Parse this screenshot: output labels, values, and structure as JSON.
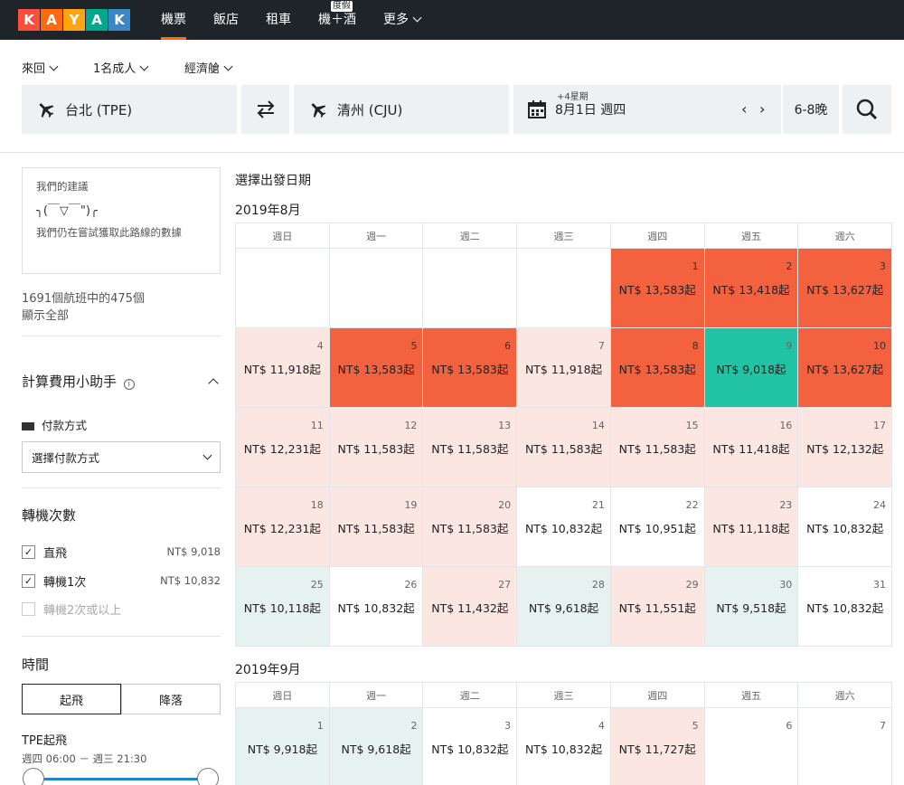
{
  "nav": {
    "logo_letters": [
      "K",
      "A",
      "Y",
      "A",
      "K"
    ],
    "logo_colors": [
      "#ff4f3a",
      "#ff690f",
      "#ffa412",
      "#00a88f",
      "#3a87c5"
    ],
    "items": [
      {
        "label": "機票",
        "active": true
      },
      {
        "label": "飯店"
      },
      {
        "label": "租車"
      },
      {
        "label": "機＋酒",
        "badge": "度假"
      },
      {
        "label": "更多"
      }
    ]
  },
  "search": {
    "trip_type": "來回",
    "travelers": "1名成人",
    "cabin": "經濟艙",
    "origin": "台北 (TPE)",
    "destination": "清州 (CJU)",
    "date_hint": "+4星期",
    "date": "8月1日 週四",
    "nights": "6-8晚"
  },
  "sidebar": {
    "advice_title": "我們的建議",
    "advice_kaomoji": "╮(￣▽￣\")╭",
    "advice_text": "我們仍在嘗試獲取此路線的數據",
    "results_count": "1691個航班中的475個",
    "show_all": "顯示全部",
    "fee_helper": "計算費用小助手",
    "payment_label": "付款方式",
    "payment_select": "選擇付款方式",
    "stops_title": "轉機次數",
    "stops": [
      {
        "label": "直飛",
        "price": "NT$ 9,018",
        "checked": true
      },
      {
        "label": "轉機1次",
        "price": "NT$ 10,832",
        "checked": true
      },
      {
        "label": "轉機2次或以上",
        "price": "",
        "checked": false
      }
    ],
    "time_title": "時間",
    "time_tabs": [
      "起飛",
      "降落"
    ],
    "tpe_depart": "TPE起飛",
    "time_range": "週四 06:00 － 週三 21:30"
  },
  "calendar": {
    "title": "選擇出發日期",
    "weekdays": [
      "週日",
      "週一",
      "週二",
      "週三",
      "週四",
      "週五",
      "週六"
    ],
    "months": [
      {
        "label": "2019年8月",
        "weeks": [
          [
            {},
            {},
            {},
            {},
            {
              "d": "1",
              "p": "NT$ 13,583起",
              "c": "high"
            },
            {
              "d": "2",
              "p": "NT$ 13,418起",
              "c": "high"
            },
            {
              "d": "3",
              "p": "NT$ 13,627起",
              "c": "high"
            }
          ],
          [
            {
              "d": "4",
              "p": "NT$ 11,918起",
              "c": "mid"
            },
            {
              "d": "5",
              "p": "NT$ 13,583起",
              "c": "high"
            },
            {
              "d": "6",
              "p": "NT$ 13,583起",
              "c": "high"
            },
            {
              "d": "7",
              "p": "NT$ 11,918起",
              "c": "mid"
            },
            {
              "d": "8",
              "p": "NT$ 13,583起",
              "c": "high"
            },
            {
              "d": "9",
              "p": "NT$ 9,018起",
              "c": "best"
            },
            {
              "d": "10",
              "p": "NT$ 13,627起",
              "c": "high"
            }
          ],
          [
            {
              "d": "11",
              "p": "NT$ 12,231起",
              "c": "mid"
            },
            {
              "d": "12",
              "p": "NT$ 11,583起",
              "c": "mid"
            },
            {
              "d": "13",
              "p": "NT$ 11,583起",
              "c": "mid"
            },
            {
              "d": "14",
              "p": "NT$ 11,583起",
              "c": "mid"
            },
            {
              "d": "15",
              "p": "NT$ 11,583起",
              "c": "mid"
            },
            {
              "d": "16",
              "p": "NT$ 11,418起",
              "c": "mid"
            },
            {
              "d": "17",
              "p": "NT$ 12,132起",
              "c": "mid"
            }
          ],
          [
            {
              "d": "18",
              "p": "NT$ 12,231起",
              "c": "mid"
            },
            {
              "d": "19",
              "p": "NT$ 11,583起",
              "c": "mid"
            },
            {
              "d": "20",
              "p": "NT$ 11,583起",
              "c": "mid"
            },
            {
              "d": "21",
              "p": "NT$ 10,832起",
              "c": "none"
            },
            {
              "d": "22",
              "p": "NT$ 10,951起",
              "c": "none"
            },
            {
              "d": "23",
              "p": "NT$ 11,118起",
              "c": "mid"
            },
            {
              "d": "24",
              "p": "NT$ 10,832起",
              "c": "none"
            }
          ],
          [
            {
              "d": "25",
              "p": "NT$ 10,118起",
              "c": "low"
            },
            {
              "d": "26",
              "p": "NT$ 10,832起",
              "c": "none"
            },
            {
              "d": "27",
              "p": "NT$ 11,432起",
              "c": "mid"
            },
            {
              "d": "28",
              "p": "NT$ 9,618起",
              "c": "low"
            },
            {
              "d": "29",
              "p": "NT$ 11,551起",
              "c": "mid"
            },
            {
              "d": "30",
              "p": "NT$ 9,518起",
              "c": "low"
            },
            {
              "d": "31",
              "p": "NT$ 10,832起",
              "c": "none"
            }
          ]
        ]
      },
      {
        "label": "2019年9月",
        "weeks": [
          [
            {
              "d": "1",
              "p": "NT$ 9,918起",
              "c": "low"
            },
            {
              "d": "2",
              "p": "NT$ 9,618起",
              "c": "low"
            },
            {
              "d": "3",
              "p": "NT$ 10,832起",
              "c": "none"
            },
            {
              "d": "4",
              "p": "NT$ 10,832起",
              "c": "none"
            },
            {
              "d": "5",
              "p": "NT$ 11,727起",
              "c": "mid"
            },
            {
              "d": "6",
              "p": "",
              "c": "none"
            },
            {
              "d": "7",
              "p": "",
              "c": "none"
            }
          ]
        ]
      }
    ]
  }
}
